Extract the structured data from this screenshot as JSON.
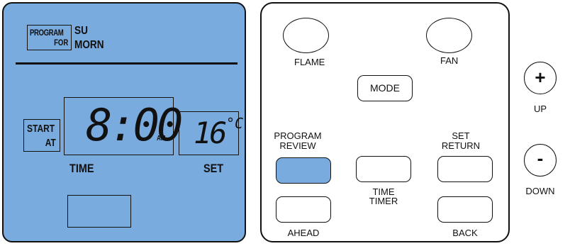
{
  "lcd": {
    "program_for_line1": "PROGRAM",
    "program_for_line2": "FOR",
    "day": "SU",
    "period": "MORN",
    "start_at_line1": "START",
    "start_at_line2": "AT",
    "time_value": "8:00",
    "time_suffix": "AM",
    "temp_value": "16",
    "temp_unit": "°C",
    "time_label": "TIME",
    "set_label": "SET",
    "background_color": "#7aabde"
  },
  "buttons": {
    "flame": "FLAME",
    "fan": "FAN",
    "mode": "MODE",
    "program_review_line1": "PROGRAM",
    "program_review_line2": "REVIEW",
    "set_return_line1": "SET",
    "set_return_line2": "RETURN",
    "time_timer_line1": "TIME",
    "time_timer_line2": "TIMER",
    "ahead": "AHEAD",
    "back": "BACK",
    "active_color": "#7aabde"
  },
  "side": {
    "up_symbol": "+",
    "up_label": "UP",
    "down_symbol": "-",
    "down_label": "DOWN"
  }
}
